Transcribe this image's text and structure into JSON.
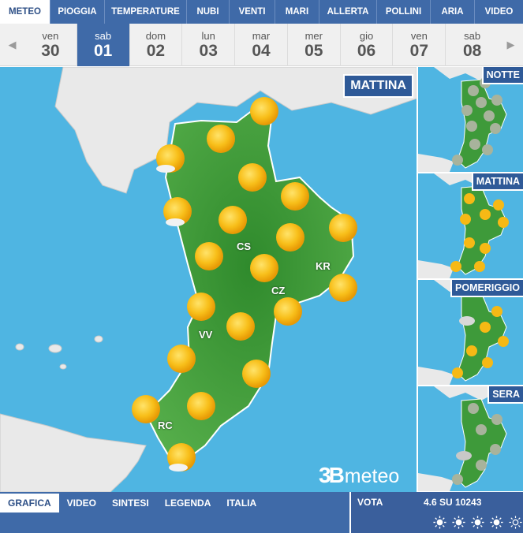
{
  "nav": {
    "tabs": [
      {
        "label": "METEO",
        "active": true
      },
      {
        "label": "PIOGGIA"
      },
      {
        "label": "TEMPERATURE"
      },
      {
        "label": "NUBI"
      },
      {
        "label": "VENTI"
      },
      {
        "label": "MARI"
      },
      {
        "label": "ALLERTA"
      },
      {
        "label": "POLLINI"
      },
      {
        "label": "ARIA"
      },
      {
        "label": "VIDEO"
      }
    ]
  },
  "days": [
    {
      "name": "ven",
      "num": "30"
    },
    {
      "name": "sab",
      "num": "01",
      "active": true
    },
    {
      "name": "dom",
      "num": "02"
    },
    {
      "name": "lun",
      "num": "03"
    },
    {
      "name": "mar",
      "num": "04"
    },
    {
      "name": "mer",
      "num": "05"
    },
    {
      "name": "gio",
      "num": "06"
    },
    {
      "name": "ven",
      "num": "07"
    },
    {
      "name": "sab",
      "num": "08"
    }
  ],
  "map": {
    "period": "MATTINA",
    "cities": [
      "CS",
      "KR",
      "CZ",
      "VV",
      "RC"
    ],
    "logo_num": "3B",
    "logo_text": "meteo"
  },
  "thumbs": [
    "NOTTE",
    "MATTINA",
    "POMERIGGIO",
    "SERA"
  ],
  "bottom": {
    "tabs": [
      {
        "label": "GRAFICA",
        "active": true
      },
      {
        "label": "VIDEO"
      },
      {
        "label": "SINTESI"
      },
      {
        "label": "LEGENDA"
      },
      {
        "label": "ITALIA"
      }
    ],
    "vote_label": "VOTA",
    "vote_score": "4.6 SU 10243",
    "rating_stars": 5
  },
  "colors": {
    "nav_blue": "#3f6aa8",
    "sea": "#4fb5e2",
    "land_green": "#3e9a3a",
    "sun": "#f6b915"
  }
}
